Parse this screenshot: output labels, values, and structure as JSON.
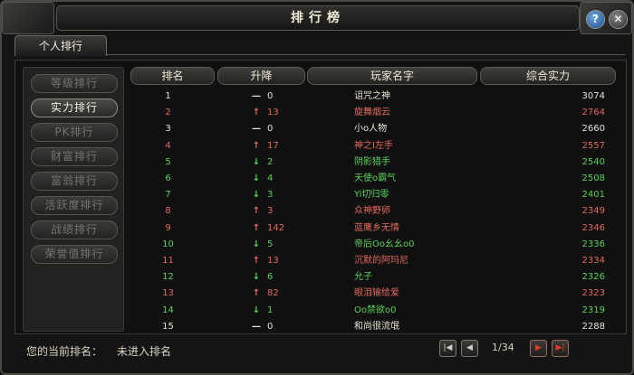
{
  "window": {
    "title": "排行榜",
    "help_label": "?",
    "close_label": "✕"
  },
  "tabs": [
    {
      "label": "个人排行"
    }
  ],
  "sidebar": {
    "items": [
      {
        "label": "等级排行",
        "active": false
      },
      {
        "label": "实力排行",
        "active": true
      },
      {
        "label": "PK排行",
        "active": false
      },
      {
        "label": "财富排行",
        "active": false
      },
      {
        "label": "富翁排行",
        "active": false
      },
      {
        "label": "活跃度排行",
        "active": false
      },
      {
        "label": "战绩排行",
        "active": false
      },
      {
        "label": "荣誉值排行",
        "active": false
      }
    ]
  },
  "table": {
    "headers": {
      "rank": "排名",
      "change": "升降",
      "name": "玩家名字",
      "power": "综合实力"
    },
    "rows": [
      {
        "rank": "1",
        "dir": "same",
        "change": "0",
        "name": "诅咒之神",
        "power": "3074",
        "color": "#e8e2d0"
      },
      {
        "rank": "2",
        "dir": "up",
        "change": "13",
        "name": "旋舞烟云",
        "power": "2764",
        "color": "#e06a5a"
      },
      {
        "rank": "3",
        "dir": "same",
        "change": "0",
        "name": "小o人物",
        "power": "2660",
        "color": "#e8e2d0"
      },
      {
        "rank": "4",
        "dir": "up",
        "change": "17",
        "name": "神之I左手",
        "power": "2557",
        "color": "#e06a5a"
      },
      {
        "rank": "5",
        "dir": "down",
        "change": "2",
        "name": "阴影猎手",
        "power": "2540",
        "color": "#5ad25a"
      },
      {
        "rank": "6",
        "dir": "down",
        "change": "4",
        "name": "天使o霸气",
        "power": "2508",
        "color": "#5ad25a"
      },
      {
        "rank": "7",
        "dir": "down",
        "change": "3",
        "name": "Yi切归零",
        "power": "2401",
        "color": "#5ad25a"
      },
      {
        "rank": "8",
        "dir": "up",
        "change": "3",
        "name": "众神野卵",
        "power": "2349",
        "color": "#e06a5a"
      },
      {
        "rank": "9",
        "dir": "up",
        "change": "142",
        "name": "蓝鹰乡无情",
        "power": "2346",
        "color": "#e06a5a"
      },
      {
        "rank": "10",
        "dir": "down",
        "change": "5",
        "name": "帝后Oo幺幺o0",
        "power": "2336",
        "color": "#5ad25a"
      },
      {
        "rank": "11",
        "dir": "up",
        "change": "13",
        "name": "沉默的阿玛尼",
        "power": "2334",
        "color": "#e06a5a"
      },
      {
        "rank": "12",
        "dir": "down",
        "change": "6",
        "name": "允子",
        "power": "2326",
        "color": "#5ad25a"
      },
      {
        "rank": "13",
        "dir": "up",
        "change": "82",
        "name": "眼泪输给爱",
        "power": "2323",
        "color": "#e06a5a"
      },
      {
        "rank": "14",
        "dir": "down",
        "change": "1",
        "name": "Oo禁欲o0",
        "power": "2319",
        "color": "#5ad25a"
      },
      {
        "rank": "15",
        "dir": "same",
        "change": "0",
        "name": "和尚很流氓",
        "power": "2288",
        "color": "#e8e2d0"
      }
    ]
  },
  "footer": {
    "my_rank_label": "您的当前排名：",
    "my_rank_value": "未进入排名",
    "page": "1/34",
    "first_label": "|◀",
    "prev_label": "◀",
    "next_label": "▶",
    "last_label": "▶|"
  },
  "colors": {
    "up": "#e06a5a",
    "down": "#5ad25a",
    "same": "#e8e2d0"
  },
  "symbols": {
    "up": "↑",
    "down": "↓",
    "same": "—"
  }
}
